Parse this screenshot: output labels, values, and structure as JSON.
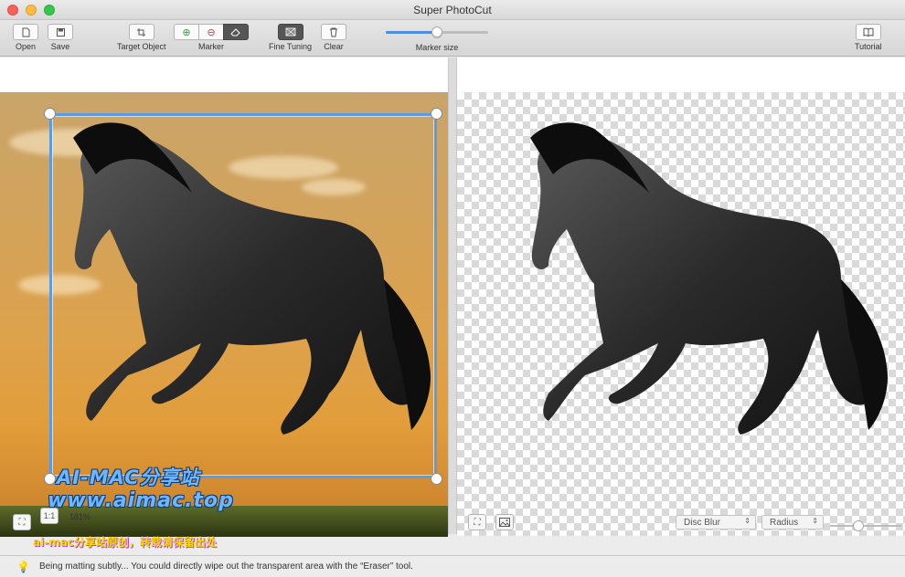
{
  "window": {
    "title": "Super PhotoCut"
  },
  "toolbar": {
    "open_label": "Open",
    "save_label": "Save",
    "target_object_label": "Target Object",
    "marker_label": "Marker",
    "fine_tuning_label": "Fine Tuning",
    "clear_label": "Clear",
    "marker_size_label": "Marker size",
    "marker_size_value": 0.5,
    "tutorial_label": "Tutorial"
  },
  "left_pane": {
    "zoom_label": "1:1",
    "zoom_percent": "181%"
  },
  "right_pane": {
    "blur_mode": "Disc Blur",
    "blur_param": "Radius",
    "radius_value": 0.4
  },
  "watermark": {
    "line1": "AI-MAC分享站",
    "line2": "www.aimac.top",
    "line3": "ai-mac分享站原创，转载请保留出处"
  },
  "status": {
    "message": "Being matting subtly... You could directly wipe out the transparent area with the “Eraser” tool."
  },
  "colors": {
    "accent": "#4a8fe0",
    "selection": "#5b9be6"
  }
}
